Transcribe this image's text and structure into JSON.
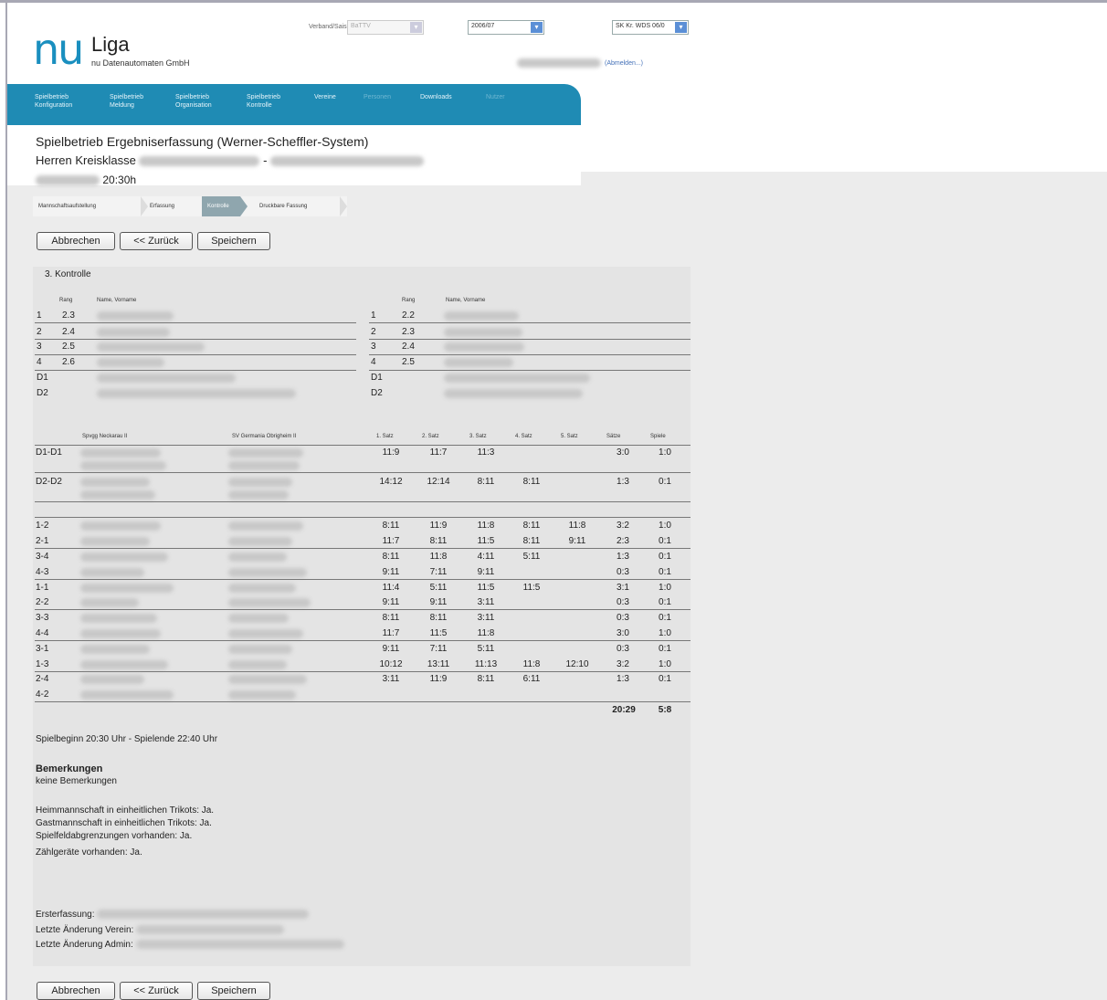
{
  "header": {
    "logo_main": "nu",
    "logo_word": "Liga",
    "logo_sub": "nu Datenautomaten GmbH",
    "verband_label": "Verband/Saison",
    "selects": {
      "verband": "BaTTV",
      "saison": "2006/07",
      "gruppe": "SK Kr. WDS 06/0"
    },
    "abmelden": "(Abmelden...)"
  },
  "nav": [
    {
      "line1": "Spielbetrieb",
      "line2": "Konfiguration"
    },
    {
      "line1": "Spielbetrieb",
      "line2": "Meldung"
    },
    {
      "line1": "Spielbetrieb",
      "line2": "Organisation"
    },
    {
      "line1": "Spielbetrieb",
      "line2": "Kontrolle"
    },
    {
      "line1": "Vereine",
      "line2": ""
    },
    {
      "line1": "Personen",
      "line2": ""
    },
    {
      "line1": "Downloads",
      "line2": ""
    },
    {
      "line1": "Nutzer",
      "line2": ""
    }
  ],
  "page": {
    "title": "Spielbetrieb Ergebniserfassung (Werner-Scheffler-System)",
    "subtitle_prefix": "Herren Kreisklasse",
    "subtitle_dash": "-",
    "time": "20:30h"
  },
  "steps": [
    "Mannschaftsaufstellung",
    "Erfassung",
    "Kontrolle",
    "Druckbare Fassung"
  ],
  "buttons": {
    "cancel": "Abbrechen",
    "back": "<< Zurück",
    "save": "Speichern"
  },
  "section_title": "3. Kontrolle",
  "lineup": {
    "col_rang": "Rang",
    "col_name": "Name, Vorname",
    "home": [
      {
        "pos": "1",
        "rang": "2.3"
      },
      {
        "pos": "2",
        "rang": "2.4"
      },
      {
        "pos": "3",
        "rang": "2.5"
      },
      {
        "pos": "4",
        "rang": "2.6"
      },
      {
        "pos": "D1",
        "rang": ""
      },
      {
        "pos": "D2",
        "rang": ""
      }
    ],
    "guest": [
      {
        "pos": "1",
        "rang": "2.2"
      },
      {
        "pos": "2",
        "rang": "2.3"
      },
      {
        "pos": "3",
        "rang": "2.4"
      },
      {
        "pos": "4",
        "rang": "2.5"
      },
      {
        "pos": "D1",
        "rang": ""
      },
      {
        "pos": "D2",
        "rang": ""
      }
    ]
  },
  "results": {
    "headers": {
      "home_team": "Spvgg Neckarau II",
      "guest_team": "SV Germania Obrigheim II",
      "set1": "1. Satz",
      "set2": "2. Satz",
      "set3": "3. Satz",
      "set4": "4. Satz",
      "set5": "5. Satz",
      "saetze": "Sätze",
      "spiele": "Spiele"
    },
    "doubles": [
      {
        "label": "D1-D1",
        "sets": [
          "11:9",
          "11:7",
          "11:3",
          "",
          ""
        ],
        "saetze": "3:0",
        "spiele": "1:0"
      },
      {
        "label": "D2-D2",
        "sets": [
          "14:12",
          "12:14",
          "8:11",
          "8:11",
          ""
        ],
        "saetze": "1:3",
        "spiele": "0:1"
      }
    ],
    "singles": [
      {
        "label": "1-2",
        "sets": [
          "8:11",
          "11:9",
          "11:8",
          "8:11",
          "11:8"
        ],
        "saetze": "3:2",
        "spiele": "1:0"
      },
      {
        "label": "2-1",
        "sets": [
          "11:7",
          "8:11",
          "11:5",
          "8:11",
          "9:11"
        ],
        "saetze": "2:3",
        "spiele": "0:1"
      },
      {
        "label": "3-4",
        "sets": [
          "8:11",
          "11:8",
          "4:11",
          "5:11",
          ""
        ],
        "saetze": "1:3",
        "spiele": "0:1"
      },
      {
        "label": "4-3",
        "sets": [
          "9:11",
          "7:11",
          "9:11",
          "",
          ""
        ],
        "saetze": "0:3",
        "spiele": "0:1"
      },
      {
        "label": "1-1",
        "sets": [
          "11:4",
          "5:11",
          "11:5",
          "11:5",
          ""
        ],
        "saetze": "3:1",
        "spiele": "1:0"
      },
      {
        "label": "2-2",
        "sets": [
          "9:11",
          "9:11",
          "3:11",
          "",
          ""
        ],
        "saetze": "0:3",
        "spiele": "0:1"
      },
      {
        "label": "3-3",
        "sets": [
          "8:11",
          "8:11",
          "3:11",
          "",
          ""
        ],
        "saetze": "0:3",
        "spiele": "0:1"
      },
      {
        "label": "4-4",
        "sets": [
          "11:7",
          "11:5",
          "11:8",
          "",
          ""
        ],
        "saetze": "3:0",
        "spiele": "1:0"
      },
      {
        "label": "3-1",
        "sets": [
          "9:11",
          "7:11",
          "5:11",
          "",
          ""
        ],
        "saetze": "0:3",
        "spiele": "0:1"
      },
      {
        "label": "1-3",
        "sets": [
          "10:12",
          "13:11",
          "11:13",
          "11:8",
          "12:10"
        ],
        "saetze": "3:2",
        "spiele": "1:0"
      },
      {
        "label": "2-4",
        "sets": [
          "3:11",
          "11:9",
          "8:11",
          "6:11",
          ""
        ],
        "saetze": "1:3",
        "spiele": "0:1"
      },
      {
        "label": "4-2",
        "sets": [
          "",
          "",
          "",
          "",
          ""
        ],
        "saetze": "",
        "spiele": ""
      }
    ],
    "total_saetze": "20:29",
    "total_spiele": "5:8"
  },
  "footer": {
    "spielzeit": "Spielbeginn 20:30 Uhr - Spielende 22:40 Uhr",
    "bemerkungen_title": "Bemerkungen",
    "bemerkungen_text": "keine Bemerkungen",
    "checks": [
      "Heimmannschaft in einheitlichen Trikots: Ja.",
      "Gastmannschaft in einheitlichen Trikots: Ja.",
      "Spielfeldabgrenzungen vorhanden: Ja.",
      "Zählgeräte vorhanden: Ja."
    ],
    "erstfassung_label": "Ersterfassung:",
    "aenderung_verein_label": "Letzte Änderung Verein:",
    "aenderung_admin_label": "Letzte Änderung Admin:"
  },
  "colors": {
    "brand": "#1f8bb4",
    "logo": "#1a8fbf",
    "panel": "#e4e4e4"
  }
}
